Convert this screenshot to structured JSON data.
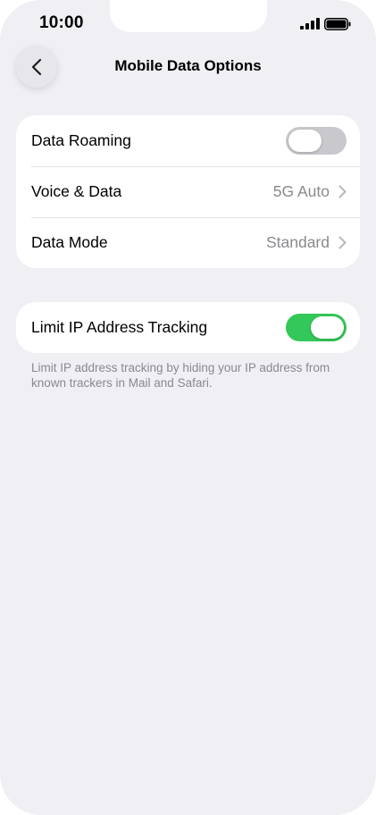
{
  "status_bar": {
    "time": "10:00"
  },
  "nav": {
    "title": "Mobile Data Options"
  },
  "main_group": {
    "rows": [
      {
        "label": "Data Roaming",
        "toggle": "off"
      },
      {
        "label": "Voice & Data",
        "value": "5G Auto"
      },
      {
        "label": "Data Mode",
        "value": "Standard"
      }
    ]
  },
  "privacy_group": {
    "rows": [
      {
        "label": "Limit IP Address Tracking",
        "toggle": "on"
      }
    ],
    "footnote": "Limit IP address tracking by hiding your IP address from known trackers in Mail and Safari."
  },
  "colors": {
    "background": "#efeff4",
    "toggle_on": "#34c759",
    "toggle_off": "#c9c9cd",
    "secondary_text": "#8a8a8e"
  },
  "icons": {
    "back": "chevron-left-icon",
    "disclosure": "chevron-right-icon",
    "signal": "cellular-signal-icon",
    "battery": "battery-icon"
  }
}
